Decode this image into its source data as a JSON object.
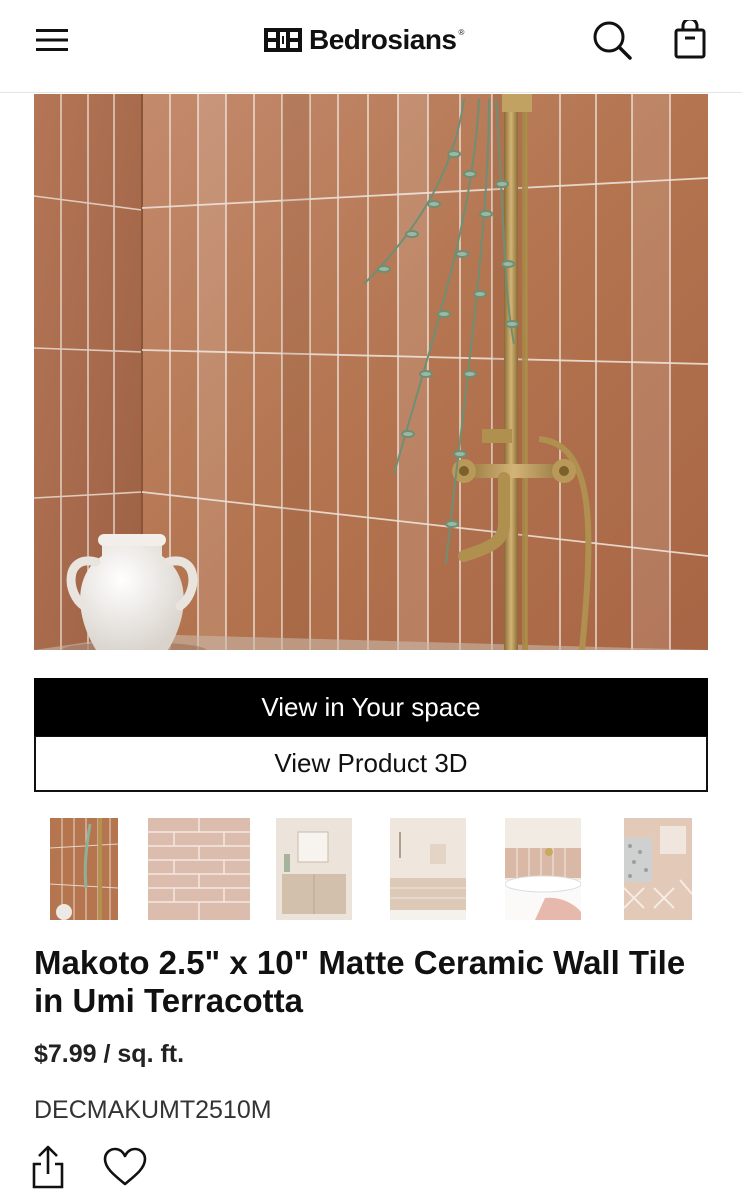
{
  "header": {
    "brand_name": "Bedrosians",
    "brand_registered": "®",
    "icons": [
      "menu-icon",
      "search-icon",
      "shopping-bag-icon"
    ]
  },
  "hero": {
    "scene": "terracotta vertical tile shower with brass fixtures, eucalyptus, white vase"
  },
  "actions": {
    "view_in_space": "View in Your space",
    "view_3d": "View Product 3D"
  },
  "thumbnails": [
    "thumbnail-1",
    "thumbnail-2",
    "thumbnail-3",
    "thumbnail-4",
    "thumbnail-5",
    "thumbnail-6"
  ],
  "product": {
    "title": "Makoto 2.5\" x 10\" Matte Ceramic Wall Tile in Umi Terracotta",
    "price": "$7.99 / sq. ft.",
    "sku": "DECMAKUMT2510M"
  },
  "footer_icons": [
    "share-icon",
    "heart-icon"
  ],
  "colors": {
    "tile": "#b57a5c",
    "grout": "#efe4dc",
    "brass": "#b08f4e",
    "button_primary": "#000000"
  }
}
